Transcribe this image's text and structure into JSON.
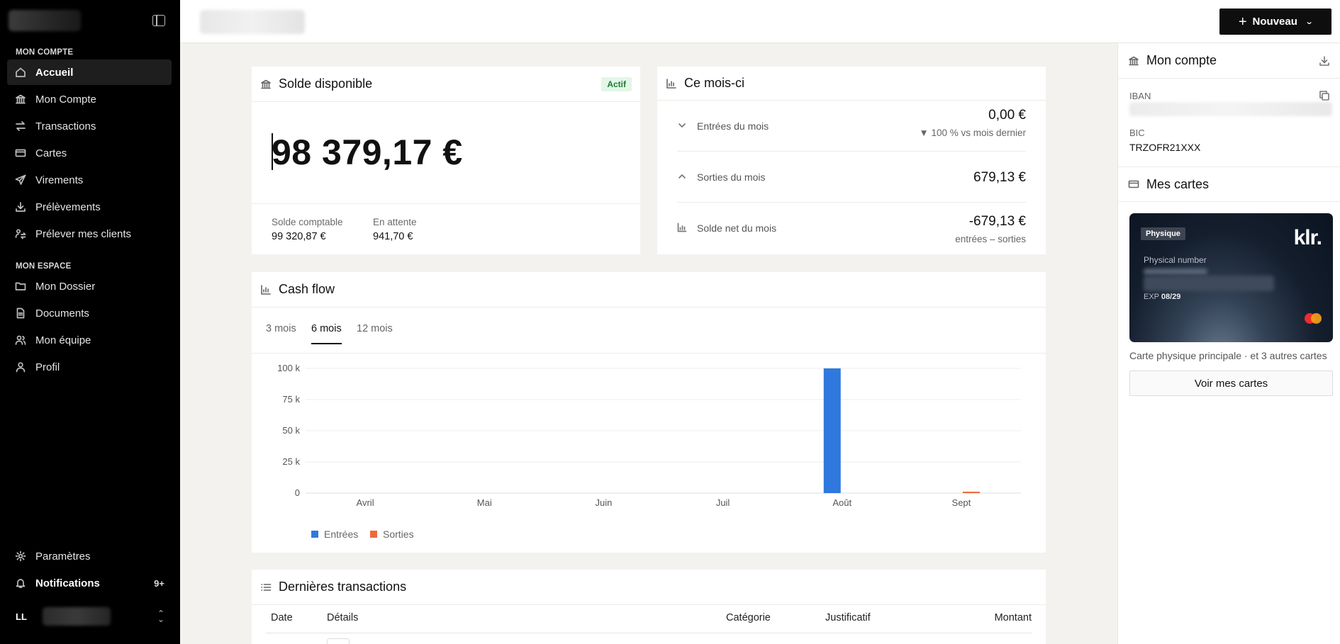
{
  "sidebar": {
    "section_account": "MON COMPTE",
    "section_space": "MON ESPACE",
    "items_account": [
      {
        "label": "Accueil",
        "icon": "home-icon"
      },
      {
        "label": "Mon Compte",
        "icon": "bank-icon"
      },
      {
        "label": "Transactions",
        "icon": "arrows-icon"
      },
      {
        "label": "Cartes",
        "icon": "card-icon"
      },
      {
        "label": "Virements",
        "icon": "send-icon"
      },
      {
        "label": "Prélèvements",
        "icon": "download-icon"
      },
      {
        "label": "Prélever mes clients",
        "icon": "users-arrows-icon"
      }
    ],
    "items_space": [
      {
        "label": "Mon Dossier",
        "icon": "folder-icon"
      },
      {
        "label": "Documents",
        "icon": "document-icon"
      },
      {
        "label": "Mon équipe",
        "icon": "team-icon"
      },
      {
        "label": "Profil",
        "icon": "user-icon"
      }
    ],
    "settings_label": "Paramètres",
    "notifications_label": "Notifications",
    "notifications_badge": "9+",
    "user_initials": "LL"
  },
  "header": {
    "new_button": "Nouveau"
  },
  "balance_card": {
    "title": "Solde disponible",
    "status": "Actif",
    "amount": "98 379,17 €",
    "accounting_label": "Solde comptable",
    "accounting_value": "99 320,87 €",
    "pending_label": "En attente",
    "pending_value": "941,70 €"
  },
  "month_card": {
    "title": "Ce mois-ci",
    "income_label": "Entrées du mois",
    "income_value": "0,00 €",
    "income_change": "▼ 100 % vs mois dernier",
    "expense_label": "Sorties du mois",
    "expense_value": "679,13 €",
    "net_label": "Solde net du mois",
    "net_value": "-679,13 €",
    "net_sub": "entrées – sorties"
  },
  "cashflow": {
    "title": "Cash flow",
    "tabs": [
      "3 mois",
      "6 mois",
      "12 mois"
    ],
    "active_tab": "6 mois"
  },
  "chart_data": {
    "type": "bar",
    "categories": [
      "Avril",
      "Mai",
      "Juin",
      "Juil",
      "Août",
      "Sept"
    ],
    "series": [
      {
        "name": "Entrées",
        "color": "#2f78de",
        "values": [
          0,
          0,
          0,
          0,
          100000,
          0
        ]
      },
      {
        "name": "Sorties",
        "color": "#ee6a3a",
        "values": [
          0,
          0,
          0,
          0,
          0,
          679.13
        ]
      }
    ],
    "yticks": [
      "0",
      "25 k",
      "50 k",
      "75 k",
      "100 k"
    ],
    "ylim": [
      0,
      100000
    ],
    "grid": true,
    "legend": "bottom-left"
  },
  "transactions": {
    "title": "Dernières transactions",
    "columns": [
      "Date",
      "Détails",
      "Catégorie",
      "Justificatif",
      "Montant"
    ]
  },
  "account_panel": {
    "title": "Mon compte",
    "iban_label": "IBAN",
    "bic_label": "BIC",
    "bic_value": "TRZOFR21XXX"
  },
  "cards_panel": {
    "title": "Mes cartes",
    "card_type": "Physique",
    "card_brand": "klr.",
    "number_label": "Physical number",
    "exp_label": "EXP",
    "exp_value": "08/29",
    "note": "Carte physique principale · et 3 autres cartes",
    "button": "Voir mes cartes"
  }
}
